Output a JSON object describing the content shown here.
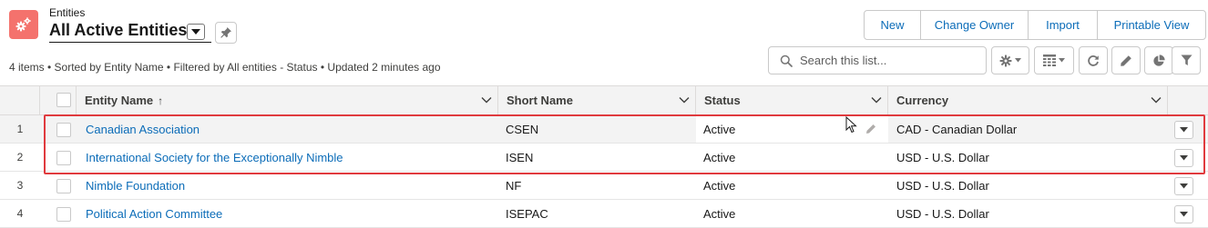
{
  "header": {
    "object_label": "Entities",
    "view_title": "All Active Entities",
    "app_icon": "gears-icon",
    "brand_color": "#f4726d",
    "list_info": "4 items • Sorted by Entity Name • Filtered by All entities - Status • Updated 2 minutes ago"
  },
  "actions": {
    "new": "New",
    "change_owner": "Change Owner",
    "import": "Import",
    "printable_view": "Printable View"
  },
  "search": {
    "placeholder": "Search this list..."
  },
  "toolbar": {
    "icons": [
      "settings-icon",
      "table-view-icon",
      "refresh-icon",
      "edit-icon",
      "chart-icon",
      "filter-icon"
    ]
  },
  "table": {
    "columns": {
      "entity_name": "Entity Name",
      "short_name": "Short Name",
      "status": "Status",
      "currency": "Currency"
    },
    "sort_indicator": "↑",
    "rows": [
      {
        "num": "1",
        "entity_name": "Canadian Association",
        "short_name": "CSEN",
        "status": "Active",
        "currency": "CAD - Canadian Dollar"
      },
      {
        "num": "2",
        "entity_name": "International Society for the Exceptionally Nimble",
        "short_name": "ISEN",
        "status": "Active",
        "currency": "USD - U.S. Dollar"
      },
      {
        "num": "3",
        "entity_name": "Nimble Foundation",
        "short_name": "NF",
        "status": "Active",
        "currency": "USD - U.S. Dollar"
      },
      {
        "num": "4",
        "entity_name": "Political Action Committee",
        "short_name": "ISEPAC",
        "status": "Active",
        "currency": "USD - U.S. Dollar"
      }
    ]
  },
  "colors": {
    "link": "#0b6cb8",
    "highlight_frame": "#e03a3e",
    "header_bg": "#f3f3f3"
  }
}
